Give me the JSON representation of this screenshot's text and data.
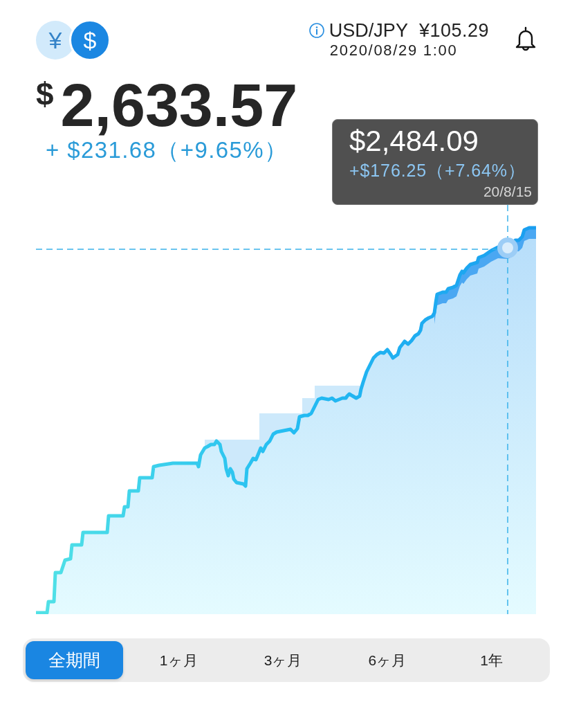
{
  "header": {
    "currency_toggle": [
      {
        "symbol": "¥",
        "selected": false
      },
      {
        "symbol": "$",
        "selected": true
      }
    ],
    "rate": {
      "pair": "USD/JPY",
      "value": "¥105.29",
      "timestamp": "2020/08/29 1:00"
    }
  },
  "balance": {
    "currency_symbol": "$",
    "amount": "2,633.57",
    "change": "+ $231.68（+9.65%）"
  },
  "chart": {
    "tooltip": {
      "value": "$2,484.09",
      "change": "+$176.25（+7.64%）",
      "date": "20/8/15"
    }
  },
  "periods": [
    {
      "label": "全期間",
      "selected": true
    },
    {
      "label": "1ヶ月",
      "selected": false
    },
    {
      "label": "3ヶ月",
      "selected": false
    },
    {
      "label": "6ヶ月",
      "selected": false
    },
    {
      "label": "1年",
      "selected": false
    }
  ]
}
